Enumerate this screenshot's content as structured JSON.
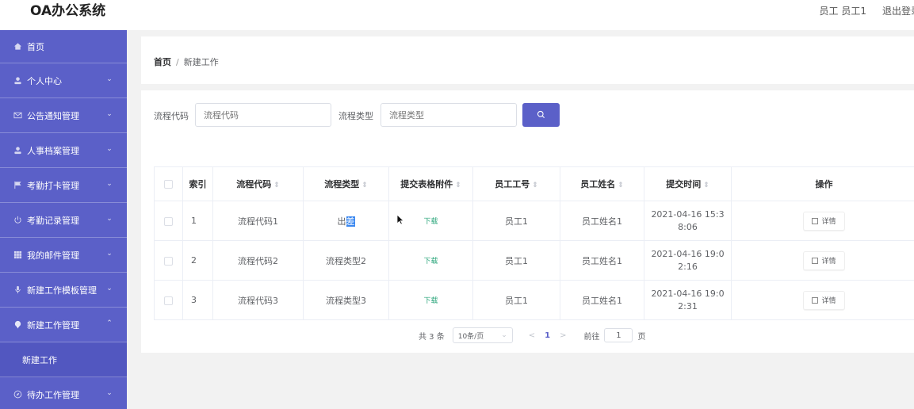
{
  "header": {
    "app_title": "OA办公系统",
    "user": "员工 员工1",
    "logout": "退出登录"
  },
  "sidebar": {
    "items": [
      {
        "label": "首页",
        "icon": "home-icon"
      },
      {
        "label": "个人中心",
        "icon": "user-icon"
      },
      {
        "label": "公告通知管理",
        "icon": "mail-icon"
      },
      {
        "label": "人事档案管理",
        "icon": "user-icon"
      },
      {
        "label": "考勤打卡管理",
        "icon": "flag-icon"
      },
      {
        "label": "考勤记录管理",
        "icon": "power-icon"
      },
      {
        "label": "我的邮件管理",
        "icon": "grid-icon"
      },
      {
        "label": "新建工作模板管理",
        "icon": "mic-icon"
      },
      {
        "label": "新建工作管理",
        "icon": "pin-icon"
      },
      {
        "label": "待办工作管理",
        "icon": "compass-icon"
      }
    ],
    "sub_item": "新建工作"
  },
  "breadcrumb": {
    "home": "首页",
    "separator": "/",
    "current": "新建工作"
  },
  "search": {
    "code_label": "流程代码",
    "code_placeholder": "流程代码",
    "type_label": "流程类型",
    "type_placeholder": "流程类型"
  },
  "table": {
    "columns": [
      "索引",
      "流程代码",
      "流程类型",
      "提交表格附件",
      "员工工号",
      "员工姓名",
      "提交时间",
      "操作"
    ],
    "rows": [
      {
        "index": "1",
        "code": "流程代码1",
        "type_a": "出",
        "type_b": "差",
        "attachment": "下载",
        "emp_no": "员工1",
        "emp_name": "员工姓名1",
        "time_a": "2021-04-16 15:3",
        "time_b": "8:06",
        "action": "详情"
      },
      {
        "index": "2",
        "code": "流程代码2",
        "type": "流程类型2",
        "attachment": "下载",
        "emp_no": "员工1",
        "emp_name": "员工姓名1",
        "time_a": "2021-04-16 19:0",
        "time_b": "2:16",
        "action": "详情"
      },
      {
        "index": "3",
        "code": "流程代码3",
        "type": "流程类型3",
        "attachment": "下载",
        "emp_no": "员工1",
        "emp_name": "员工姓名1",
        "time_a": "2021-04-16 19:0",
        "time_b": "2:31",
        "action": "详情"
      }
    ]
  },
  "pagination": {
    "total": "共 3 条",
    "page_size": "10条/页",
    "current": "1",
    "goto_label": "前往",
    "goto_value": "1",
    "page_suffix": "页"
  },
  "colors": {
    "accent": "#5b60c8",
    "download": "#2aa57a"
  }
}
